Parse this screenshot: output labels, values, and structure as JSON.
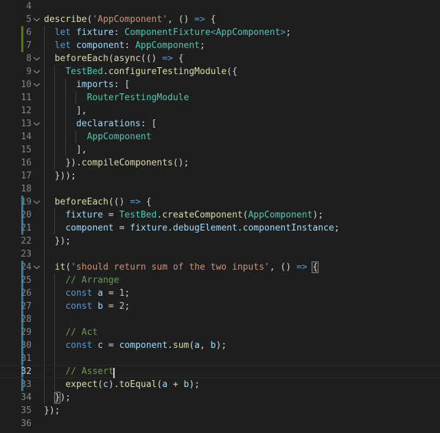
{
  "editor": {
    "theme": "Dark+ (default dark)",
    "language": "TypeScript",
    "font_size_px": 13,
    "line_height_px": 19,
    "colors": {
      "background": "#1e1e1e",
      "foreground": "#d4d4d4",
      "line_number": "#858585",
      "line_number_active": "#c6c6c6",
      "keyword": "#569cd6",
      "function": "#dcdcaa",
      "string": "#ce9178",
      "type": "#4ec9b0",
      "variable": "#9cdcfe",
      "number": "#b5cea8",
      "comment": "#6a9955",
      "indent_guide": "#404040",
      "diff_added": "#587c0c",
      "diff_modified": "#1b81a8",
      "current_line_border": "#282828",
      "bracket_match_border": "#888888",
      "cursor": "#d4d4d4"
    },
    "cursor": {
      "line": 32,
      "column": 15
    },
    "first_visible_line": 4,
    "last_visible_line": 36,
    "lines": [
      {
        "number": 4,
        "text": "",
        "fold": null,
        "diff": null,
        "current": false,
        "guides": 0,
        "tokens": []
      },
      {
        "number": 5,
        "text": "describe('AppComponent', () => {",
        "fold": "open",
        "diff": null,
        "current": false,
        "guides": 0,
        "tokens": [
          {
            "t": "describe",
            "c": "fn"
          },
          {
            "t": "(",
            "c": "pun"
          },
          {
            "t": "'AppComponent'",
            "c": "str"
          },
          {
            "t": ", ",
            "c": "pun"
          },
          {
            "t": "()",
            "c": "pun"
          },
          {
            "t": " ",
            "c": "pun"
          },
          {
            "t": "=>",
            "c": "arrow"
          },
          {
            "t": " {",
            "c": "pun"
          }
        ]
      },
      {
        "number": 6,
        "text": "  let fixture: ComponentFixture<AppComponent>;",
        "fold": null,
        "diff": "add",
        "current": false,
        "guides": 1,
        "tokens": [
          {
            "t": "  ",
            "c": "pun"
          },
          {
            "t": "let",
            "c": "kw"
          },
          {
            "t": " ",
            "c": "pun"
          },
          {
            "t": "fixture",
            "c": "var"
          },
          {
            "t": ": ",
            "c": "pun"
          },
          {
            "t": "ComponentFixture",
            "c": "type"
          },
          {
            "t": "<",
            "c": "kw"
          },
          {
            "t": "AppComponent",
            "c": "type"
          },
          {
            "t": ">",
            "c": "kw"
          },
          {
            "t": ";",
            "c": "pun"
          }
        ]
      },
      {
        "number": 7,
        "text": "  let component: AppComponent;",
        "fold": null,
        "diff": "add",
        "current": false,
        "guides": 1,
        "tokens": [
          {
            "t": "  ",
            "c": "pun"
          },
          {
            "t": "let",
            "c": "kw"
          },
          {
            "t": " ",
            "c": "pun"
          },
          {
            "t": "component",
            "c": "var"
          },
          {
            "t": ": ",
            "c": "pun"
          },
          {
            "t": "AppComponent",
            "c": "type"
          },
          {
            "t": ";",
            "c": "pun"
          }
        ]
      },
      {
        "number": 8,
        "text": "  beforeEach(async(() => {",
        "fold": "open",
        "diff": null,
        "current": false,
        "guides": 1,
        "tokens": [
          {
            "t": "  ",
            "c": "pun"
          },
          {
            "t": "beforeEach",
            "c": "fn"
          },
          {
            "t": "(",
            "c": "pun"
          },
          {
            "t": "async",
            "c": "fn"
          },
          {
            "t": "(()",
            "c": "pun"
          },
          {
            "t": " ",
            "c": "pun"
          },
          {
            "t": "=>",
            "c": "arrow"
          },
          {
            "t": " {",
            "c": "pun"
          }
        ]
      },
      {
        "number": 9,
        "text": "    TestBed.configureTestingModule({",
        "fold": "open",
        "diff": null,
        "current": false,
        "guides": 2,
        "tokens": [
          {
            "t": "    ",
            "c": "pun"
          },
          {
            "t": "TestBed",
            "c": "type"
          },
          {
            "t": ".",
            "c": "pun"
          },
          {
            "t": "configureTestingModule",
            "c": "fn"
          },
          {
            "t": "({",
            "c": "pun"
          }
        ]
      },
      {
        "number": 10,
        "text": "      imports: [",
        "fold": "open",
        "diff": null,
        "current": false,
        "guides": 3,
        "tokens": [
          {
            "t": "      ",
            "c": "pun"
          },
          {
            "t": "imports",
            "c": "var"
          },
          {
            "t": ": [",
            "c": "pun"
          }
        ]
      },
      {
        "number": 11,
        "text": "        RouterTestingModule",
        "fold": null,
        "diff": null,
        "current": false,
        "guides": 4,
        "tokens": [
          {
            "t": "        ",
            "c": "pun"
          },
          {
            "t": "RouterTestingModule",
            "c": "type"
          }
        ]
      },
      {
        "number": 12,
        "text": "      ],",
        "fold": null,
        "diff": null,
        "current": false,
        "guides": 3,
        "tokens": [
          {
            "t": "      ",
            "c": "pun"
          },
          {
            "t": "],",
            "c": "pun"
          }
        ]
      },
      {
        "number": 13,
        "text": "      declarations: [",
        "fold": "open",
        "diff": null,
        "current": false,
        "guides": 3,
        "tokens": [
          {
            "t": "      ",
            "c": "pun"
          },
          {
            "t": "declarations",
            "c": "var"
          },
          {
            "t": ": [",
            "c": "pun"
          }
        ]
      },
      {
        "number": 14,
        "text": "        AppComponent",
        "fold": null,
        "diff": null,
        "current": false,
        "guides": 4,
        "tokens": [
          {
            "t": "        ",
            "c": "pun"
          },
          {
            "t": "AppComponent",
            "c": "type"
          }
        ]
      },
      {
        "number": 15,
        "text": "      ],",
        "fold": null,
        "diff": null,
        "current": false,
        "guides": 3,
        "tokens": [
          {
            "t": "      ",
            "c": "pun"
          },
          {
            "t": "],",
            "c": "pun"
          }
        ]
      },
      {
        "number": 16,
        "text": "    }).compileComponents();",
        "fold": null,
        "diff": null,
        "current": false,
        "guides": 2,
        "tokens": [
          {
            "t": "    ",
            "c": "pun"
          },
          {
            "t": "})",
            "c": "pun"
          },
          {
            "t": ".",
            "c": "pun"
          },
          {
            "t": "compileComponents",
            "c": "fn"
          },
          {
            "t": "();",
            "c": "pun"
          }
        ]
      },
      {
        "number": 17,
        "text": "  }));",
        "fold": null,
        "diff": null,
        "current": false,
        "guides": 1,
        "tokens": [
          {
            "t": "  ",
            "c": "pun"
          },
          {
            "t": "}));",
            "c": "pun"
          }
        ]
      },
      {
        "number": 18,
        "text": "",
        "fold": null,
        "diff": null,
        "current": false,
        "guides": 1,
        "tokens": []
      },
      {
        "number": 19,
        "text": "  beforeEach(() => {",
        "fold": "open",
        "diff": "mod",
        "current": false,
        "guides": 1,
        "tokens": [
          {
            "t": "  ",
            "c": "pun"
          },
          {
            "t": "beforeEach",
            "c": "fn"
          },
          {
            "t": "(()",
            "c": "pun"
          },
          {
            "t": " ",
            "c": "pun"
          },
          {
            "t": "=>",
            "c": "arrow"
          },
          {
            "t": " {",
            "c": "pun"
          }
        ]
      },
      {
        "number": 20,
        "text": "    fixture = TestBed.createComponent(AppComponent);",
        "fold": null,
        "diff": "mod",
        "current": false,
        "guides": 2,
        "tokens": [
          {
            "t": "    ",
            "c": "pun"
          },
          {
            "t": "fixture",
            "c": "var"
          },
          {
            "t": " = ",
            "c": "pun"
          },
          {
            "t": "TestBed",
            "c": "type"
          },
          {
            "t": ".",
            "c": "pun"
          },
          {
            "t": "createComponent",
            "c": "fn"
          },
          {
            "t": "(",
            "c": "pun"
          },
          {
            "t": "AppComponent",
            "c": "type"
          },
          {
            "t": ");",
            "c": "pun"
          }
        ]
      },
      {
        "number": 21,
        "text": "    component = fixture.debugElement.componentInstance;",
        "fold": null,
        "diff": "mod",
        "current": false,
        "guides": 2,
        "tokens": [
          {
            "t": "    ",
            "c": "pun"
          },
          {
            "t": "component",
            "c": "var"
          },
          {
            "t": " = ",
            "c": "pun"
          },
          {
            "t": "fixture",
            "c": "var"
          },
          {
            "t": ".",
            "c": "pun"
          },
          {
            "t": "debugElement",
            "c": "var"
          },
          {
            "t": ".",
            "c": "pun"
          },
          {
            "t": "componentInstance",
            "c": "var"
          },
          {
            "t": ";",
            "c": "pun"
          }
        ]
      },
      {
        "number": 22,
        "text": "  });",
        "fold": null,
        "diff": null,
        "current": false,
        "guides": 1,
        "tokens": [
          {
            "t": "  ",
            "c": "pun"
          },
          {
            "t": "});",
            "c": "pun"
          }
        ]
      },
      {
        "number": 23,
        "text": "",
        "fold": null,
        "diff": null,
        "current": false,
        "guides": 1,
        "tokens": []
      },
      {
        "number": 24,
        "text": "  it('should return sum of the two inputs', () => {",
        "fold": "open",
        "diff": "mod",
        "current": false,
        "guides": 1,
        "bracket_match_end": true,
        "tokens": [
          {
            "t": "  ",
            "c": "pun"
          },
          {
            "t": "it",
            "c": "fn"
          },
          {
            "t": "(",
            "c": "pun"
          },
          {
            "t": "'should return sum of the two inputs'",
            "c": "str"
          },
          {
            "t": ", ",
            "c": "pun"
          },
          {
            "t": "()",
            "c": "pun"
          },
          {
            "t": " ",
            "c": "pun"
          },
          {
            "t": "=>",
            "c": "arrow"
          },
          {
            "t": " ",
            "c": "pun"
          },
          {
            "t": "{",
            "c": "pun",
            "bracket": true
          }
        ]
      },
      {
        "number": 25,
        "text": "    // Arrange",
        "fold": null,
        "diff": "mod",
        "current": false,
        "guides": 2,
        "tokens": [
          {
            "t": "    ",
            "c": "pun"
          },
          {
            "t": "// Arrange",
            "c": "com"
          }
        ]
      },
      {
        "number": 26,
        "text": "    const a = 1;",
        "fold": null,
        "diff": "mod",
        "current": false,
        "guides": 2,
        "tokens": [
          {
            "t": "    ",
            "c": "pun"
          },
          {
            "t": "const",
            "c": "kw"
          },
          {
            "t": " ",
            "c": "pun"
          },
          {
            "t": "a",
            "c": "var"
          },
          {
            "t": " = ",
            "c": "pun"
          },
          {
            "t": "1",
            "c": "num"
          },
          {
            "t": ";",
            "c": "pun"
          }
        ]
      },
      {
        "number": 27,
        "text": "    const b = 2;",
        "fold": null,
        "diff": "mod",
        "current": false,
        "guides": 2,
        "tokens": [
          {
            "t": "    ",
            "c": "pun"
          },
          {
            "t": "const",
            "c": "kw"
          },
          {
            "t": " ",
            "c": "pun"
          },
          {
            "t": "b",
            "c": "var"
          },
          {
            "t": " = ",
            "c": "pun"
          },
          {
            "t": "2",
            "c": "num"
          },
          {
            "t": ";",
            "c": "pun"
          }
        ]
      },
      {
        "number": 28,
        "text": "",
        "fold": null,
        "diff": "mod",
        "current": false,
        "guides": 2,
        "tokens": []
      },
      {
        "number": 29,
        "text": "    // Act",
        "fold": null,
        "diff": "mod",
        "current": false,
        "guides": 2,
        "tokens": [
          {
            "t": "    ",
            "c": "pun"
          },
          {
            "t": "// Act",
            "c": "com"
          }
        ]
      },
      {
        "number": 30,
        "text": "    const c = component.sum(a, b);",
        "fold": null,
        "diff": "mod",
        "current": false,
        "guides": 2,
        "tokens": [
          {
            "t": "    ",
            "c": "pun"
          },
          {
            "t": "const",
            "c": "kw"
          },
          {
            "t": " ",
            "c": "pun"
          },
          {
            "t": "c",
            "c": "var"
          },
          {
            "t": " = ",
            "c": "pun"
          },
          {
            "t": "component",
            "c": "var"
          },
          {
            "t": ".",
            "c": "pun"
          },
          {
            "t": "sum",
            "c": "fn"
          },
          {
            "t": "(",
            "c": "pun"
          },
          {
            "t": "a",
            "c": "var"
          },
          {
            "t": ", ",
            "c": "pun"
          },
          {
            "t": "b",
            "c": "var"
          },
          {
            "t": ");",
            "c": "pun"
          }
        ]
      },
      {
        "number": 31,
        "text": "",
        "fold": null,
        "diff": "mod",
        "current": false,
        "guides": 2,
        "tokens": []
      },
      {
        "number": 32,
        "text": "    // Assert",
        "fold": null,
        "diff": "mod",
        "current": true,
        "guides": 2,
        "cursor_after": true,
        "tokens": [
          {
            "t": "    ",
            "c": "pun"
          },
          {
            "t": "// Assert",
            "c": "com"
          }
        ]
      },
      {
        "number": 33,
        "text": "    expect(c).toEqual(a + b);",
        "fold": null,
        "diff": "mod",
        "current": false,
        "guides": 2,
        "tokens": [
          {
            "t": "    ",
            "c": "pun"
          },
          {
            "t": "expect",
            "c": "fn"
          },
          {
            "t": "(",
            "c": "pun"
          },
          {
            "t": "c",
            "c": "var"
          },
          {
            "t": ")",
            "c": "pun"
          },
          {
            "t": ".",
            "c": "pun"
          },
          {
            "t": "toEqual",
            "c": "fn"
          },
          {
            "t": "(",
            "c": "pun"
          },
          {
            "t": "a",
            "c": "var"
          },
          {
            "t": " + ",
            "c": "pun"
          },
          {
            "t": "b",
            "c": "var"
          },
          {
            "t": ");",
            "c": "pun"
          }
        ]
      },
      {
        "number": 34,
        "text": "  });",
        "fold": null,
        "diff": null,
        "current": false,
        "guides": 1,
        "bracket_match_start": true,
        "tokens": [
          {
            "t": "  ",
            "c": "pun"
          },
          {
            "t": "}",
            "c": "pun",
            "bracket": true
          },
          {
            "t": ");",
            "c": "pun"
          }
        ]
      },
      {
        "number": 35,
        "text": "});",
        "fold": null,
        "diff": null,
        "current": false,
        "guides": 0,
        "tokens": [
          {
            "t": "});",
            "c": "pun"
          }
        ]
      },
      {
        "number": 36,
        "text": "",
        "fold": null,
        "diff": null,
        "current": false,
        "guides": 0,
        "tokens": []
      }
    ]
  }
}
